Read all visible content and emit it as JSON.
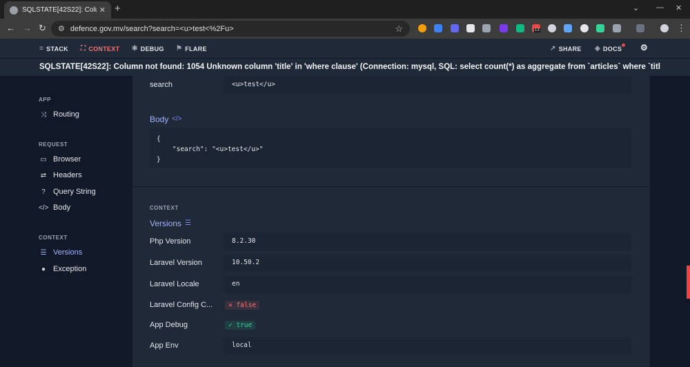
{
  "browser": {
    "tab_title": "SQLSTATE[42S22]: Column not f",
    "new_tab": "+",
    "url": "defence.gov.mv/search?search=<u>test<%2Fu>",
    "badge_count": "13"
  },
  "nav": {
    "stack": "STACK",
    "context": "CONTEXT",
    "debug": "DEBUG",
    "flare": "FLARE",
    "share": "SHARE",
    "docs": "DOCS"
  },
  "error_message": "SQLSTATE[42S22]: Column not found: 1054 Unknown column 'title' in 'where clause' (Connection: mysql, SQL: select count(*) as aggregate from `articles` where `title` LIKE %<u>test</u>...",
  "sidebar": {
    "app_title": "APP",
    "routing": "Routing",
    "request_title": "REQUEST",
    "browser": "Browser",
    "headers": "Headers",
    "query_string": "Query String",
    "body": "Body",
    "context_title": "CONTEXT",
    "versions": "Versions",
    "exception": "Exception"
  },
  "main": {
    "query_row": {
      "key": "search",
      "value": "<u>test</u>"
    },
    "body_title": "Body",
    "body_code": [
      "{",
      "    \"search\": \"<u>test</u>\"",
      "}"
    ],
    "context_label": "CONTEXT",
    "versions_title": "Versions",
    "versions": [
      {
        "key": "Php Version",
        "value": "8.2.30"
      },
      {
        "key": "Laravel Version",
        "value": "10.50.2"
      },
      {
        "key": "Laravel Locale",
        "value": "en"
      },
      {
        "key": "Laravel Config C...",
        "value": "false"
      },
      {
        "key": "App Debug",
        "value": "true"
      },
      {
        "key": "App Env",
        "value": "local"
      }
    ]
  },
  "colors": {
    "accent": "#a5b4fc",
    "error": "#f87171",
    "success": "#34d399"
  }
}
